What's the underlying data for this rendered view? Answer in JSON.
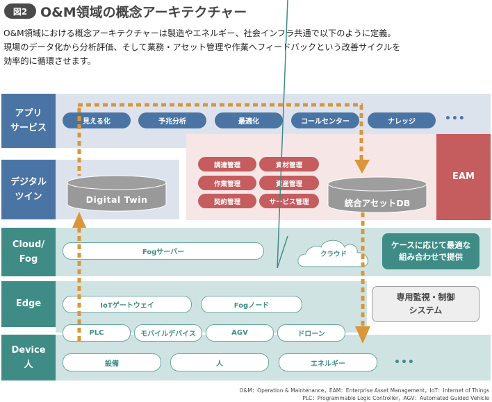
{
  "header": {
    "badge": "図2",
    "title": "O&M領域の概念アーキテクチャー",
    "description": [
      "O&M領域における概念アーキテクチャーは製造やエネルギー、社会インフラ共通で以下のように定義。",
      "現場のデータ化から分析評価、そして業務・アセット管理や作業へフィードバックという改善サイクルを",
      "効率的に循環させます。"
    ]
  },
  "colors": {
    "layer_blue": "#4a74a4",
    "layer_teal": "#3f8c87",
    "band_light_blue": "#dde3ed",
    "band_pink": "#f6e6e6",
    "band_teal": "#cfe3e2",
    "eam_red": "#c55c5e",
    "flow_arrow": "#d9963a",
    "cylinder_gray": "#999999"
  },
  "layers": {
    "app": {
      "label_line1": "アプリ",
      "label_line2": "サービス",
      "items": [
        "見える化",
        "予兆分析",
        "最適化",
        "コールセンター",
        "ナレッジ"
      ],
      "more": "•••"
    },
    "digital": {
      "label_line1": "デジタル",
      "label_line2": "ツイン",
      "twin_db": "Digital Twin"
    },
    "eam": {
      "label": "EAM",
      "items": [
        "調達管理",
        "資材管理",
        "作業管理",
        "資産管理",
        "契約管理",
        "サービス管理"
      ],
      "asset_db": "統合アセットDB"
    },
    "cloud": {
      "label_line1": "Cloud/",
      "label_line2": "Fog",
      "fog_server": "Fogサーバー",
      "cloud": "クラウド",
      "callout_line1": "ケースに応じて最適な",
      "callout_line2": "組み合わせで提供"
    },
    "edge": {
      "label": "Edge",
      "items": [
        "IoTゲートウェイ",
        "Fogノード"
      ],
      "sub_items": [
        "PLC",
        "モバイルデバイス",
        "AGV",
        "ドローン"
      ],
      "dedicated_line1": "専用監視・制御",
      "dedicated_line2": "システム"
    },
    "device": {
      "label_line1": "Device",
      "label_line2": "人",
      "items": [
        "設備",
        "人",
        "エネルギー"
      ],
      "more": "•••"
    }
  },
  "footnotes": [
    "O&M：Operation & Maintenance，EAM：Enterprise Asset Management，IoT：Internet of Things",
    "PLC：Programmable Logic Controller，AGV：Automated Guided Vehicle"
  ]
}
